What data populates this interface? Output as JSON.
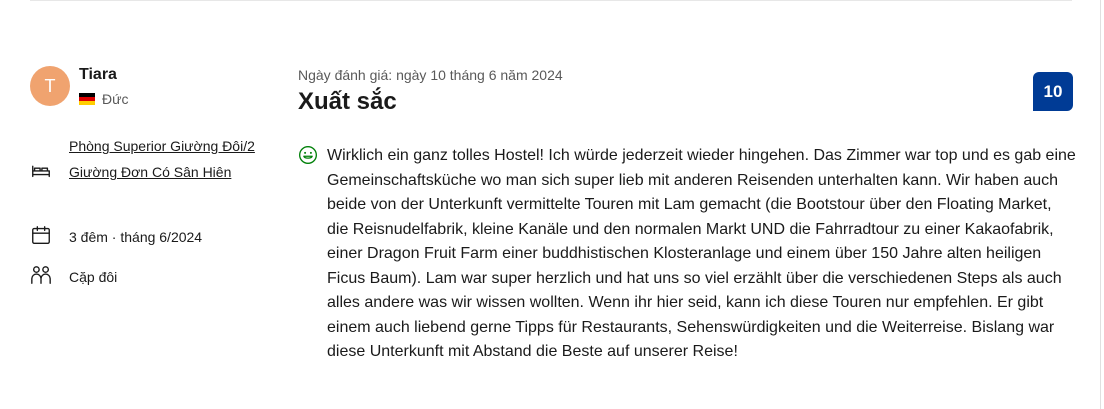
{
  "reviewer": {
    "avatar_letter": "T",
    "avatar_color": "#f0a36f",
    "name": "Tiara",
    "country": "Đức",
    "flag": "germany-flag"
  },
  "stay": {
    "room_type": "Phòng Superior Giường Đôi/2 Giường Đơn Có Sân Hiên",
    "nights_date": "3 đêm · tháng 6/2024",
    "traveler_type": "Cặp đôi",
    "icons": {
      "room": "bed-icon",
      "date": "calendar-icon",
      "traveler": "people-icon"
    }
  },
  "review": {
    "date": "Ngày đánh giá: ngày 10 tháng 6 năm 2024",
    "title": "Xuất sắc",
    "score": "10",
    "score_color": "#003b95",
    "positive_icon": "smile-icon",
    "positive_icon_color": "#008009",
    "text": "Wirklich ein ganz tolles Hostel! Ich würde jederzeit wieder hingehen. Das Zimmer war top und es gab eine Gemeinschaftsküche wo man sich super lieb mit anderen Reisenden unterhalten kann. Wir haben auch beide von der Unterkunft vermittelte Touren mit Lam gemacht (die Bootstour über den Floating Market, die Reisnudelfabrik, kleine Kanäle und den normalen Markt UND die Fahrradtour zu einer Kakaofabrik, einer Dragon Fruit Farm einer buddhistischen Klosteranlage und einem über 150 Jahre alten heiligen Ficus Baum). Lam war super herzlich und hat uns so viel erzählt über die verschiedenen Steps als auch alles andere was wir wissen wollten. Wenn ihr hier seid, kann ich diese Touren nur empfehlen. Er gibt einem auch liebend gerne Tipps für Restaurants, Sehenswürdigkeiten und die Weiterreise. Bislang war diese Unterkunft mit Abstand die Beste auf unserer Reise!"
  }
}
